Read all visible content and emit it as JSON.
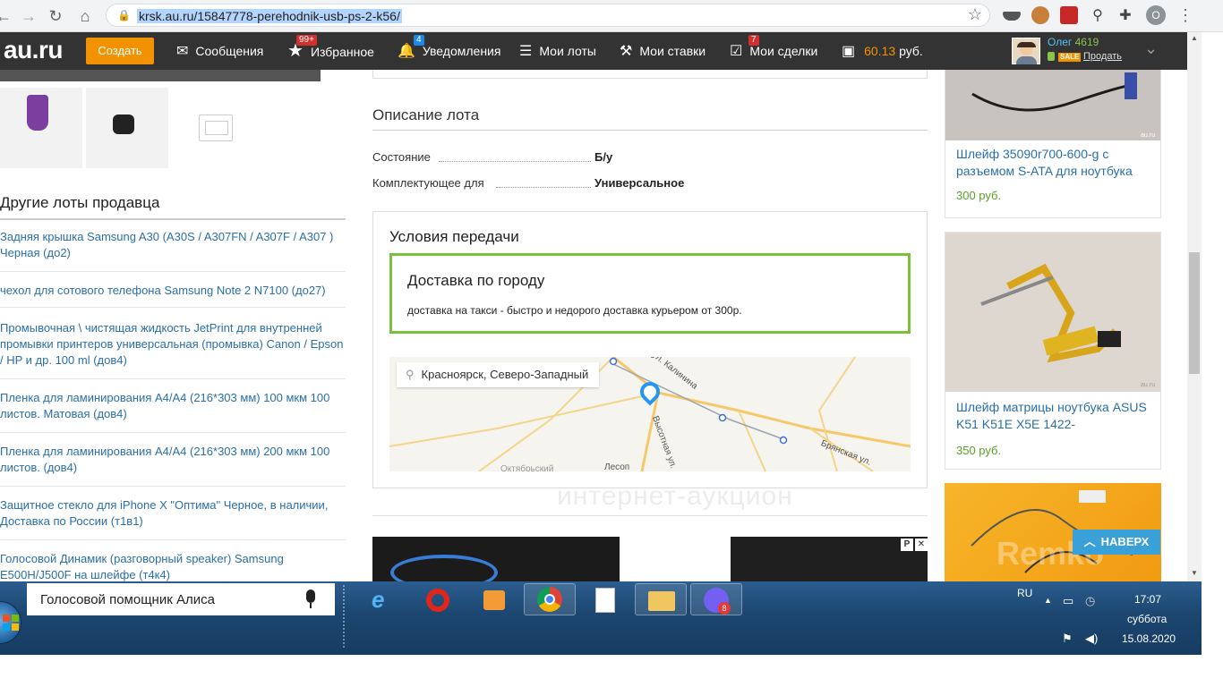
{
  "browser": {
    "url": "krsk.au.ru/15847778-perehodnik-usb-ps-2-k56/",
    "profile_letter": "О"
  },
  "site": {
    "logo": "au.ru",
    "create_label": "Создать",
    "nav": {
      "messages": "Сообщения",
      "favorites": "Избранное",
      "favorites_badge": "99+",
      "notifications": "Уведомления",
      "notifications_badge": "4",
      "my_lots": "Мои лоты",
      "my_bids": "Мои ставки",
      "my_deals": "Мои сделки",
      "my_deals_badge": "7"
    },
    "balance_amount": "60.13",
    "balance_currency": "руб.",
    "user": {
      "name": "Олег",
      "rating": "4619",
      "sale_badge": "SALE",
      "sell_link": "Продать"
    }
  },
  "left": {
    "other_lots_title": "Другие лоты продавца",
    "lots": [
      "Задняя крышка Samsung A30 (A30S / A307FN / A307F / A307 ) Черная (до2)",
      "чехол для сотового телефона Samsung Note 2 N7100 (до27)",
      "Промывочная \\ чистящая жидкость JetPrint для внутренней промывки принтеров универсальная (промывка) Canon / Epson / HP и др. 100 ml (дов4)",
      "Пленка для ламинирования А4/А4 (216*303 мм) 100 мкм 100 листов. Матовая (дов4)",
      "Пленка для ламинирования А4/А4 (216*303 мм) 200 мкм 100 листов. (дов4)",
      "Защитное стекло для iPhone X \"Оптима\" Черное, в наличии, Доставка по России (т1в1)",
      "Голосовой Динамик (разговорный speaker) Samsung E500H/J500F на шлейфе (т4к4)"
    ]
  },
  "description": {
    "title": "Описание лота",
    "props": [
      {
        "name": "Состояние",
        "value": "Б/у"
      },
      {
        "name": "Комплектующее для",
        "value": "Универсальное"
      }
    ]
  },
  "transfer": {
    "title": "Условия передачи",
    "delivery_title": "Доставка по городу",
    "delivery_text": "доставка на такси - быстро и недорого доставка курьером от 300р.",
    "map_location": "Красноярск, Северо-Западный",
    "street_labels": [
      "ул. Калинина",
      "Высотная ул.",
      "Брянская ул.",
      "Октябрьский",
      "Лесоп"
    ],
    "watermark": "интернет-аукцион"
  },
  "ad": {
    "badge": "P",
    "close": "✕"
  },
  "right": {
    "cards": [
      {
        "title": "Шлейф 35090r700-600-g с разъемом S-ATA для ноутбука",
        "price": "300 руб.",
        "img_caption": "au.ru"
      },
      {
        "title": "Шлейф матрицы ноутбука ASUS K51 K51E X5E 1422-",
        "price": "350 руб.",
        "img_caption": "au.ru"
      },
      {
        "title": "",
        "price": "",
        "img_caption": "Remko"
      }
    ],
    "top_button": "НАВЕРХ"
  },
  "taskbar": {
    "search_text": "Голосовой помощник Алиса",
    "viber_badge": "8",
    "lang": "RU",
    "time": "17:07",
    "day": "суббота",
    "date": "15.08.2020"
  },
  "colors": {
    "accent_orange": "#f39200",
    "link_blue": "#2a6fa8",
    "price_green": "#5aa02c",
    "delivery_green": "#7cc13e",
    "topbar": "#333333"
  }
}
